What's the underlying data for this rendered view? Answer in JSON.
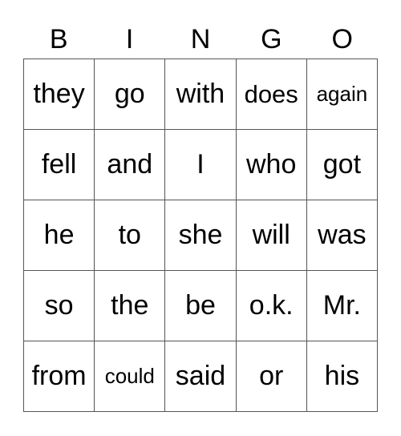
{
  "header": [
    "B",
    "I",
    "N",
    "G",
    "O"
  ],
  "rows": [
    [
      "they",
      "go",
      "with",
      "does",
      "again"
    ],
    [
      "fell",
      "and",
      "I",
      "who",
      "got"
    ],
    [
      "he",
      "to",
      "she",
      "will",
      "was"
    ],
    [
      "so",
      "the",
      "be",
      "o.k.",
      "Mr."
    ],
    [
      "from",
      "could",
      "said",
      "or",
      "his"
    ]
  ]
}
